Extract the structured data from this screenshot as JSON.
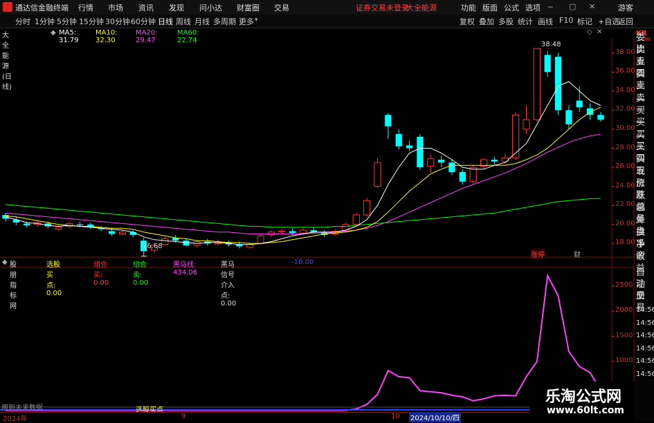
{
  "titlebar": {
    "app_name": "通达信金融终端",
    "menus": [
      "行情",
      "市场",
      "资讯",
      "发现",
      "问小达",
      "财富圈",
      "交易"
    ],
    "warning": "证券交易未登录",
    "stock_name": "大全能源",
    "right_menus": [
      "功能",
      "版面",
      "公式",
      "选项"
    ],
    "user": "游客"
  },
  "tabs": {
    "periods": [
      "分时",
      "1分钟",
      "5分钟",
      "15分钟",
      "30分钟",
      "60分钟",
      "日线",
      "周线",
      "月线",
      "多周期",
      "更多"
    ],
    "active": "日线",
    "tools": [
      "复权",
      "叠加",
      "多股",
      "统计",
      "画线",
      "F10",
      "标记",
      "+自选",
      "返回"
    ]
  },
  "legend": {
    "title": "大全能源(日线)",
    "ma5": "MA5: 31.79",
    "ma10": "MA10: 32.30",
    "ma20": "MA20: 29.47",
    "ma60": "MA60: 22.74",
    "colors": {
      "ma5": "#ffffff",
      "ma10": "#ffff00",
      "ma20": "#ff40ff",
      "ma60": "#00ff00"
    }
  },
  "price_axis": {
    "ticks": [
      "38.00",
      "36.00",
      "34.00",
      "32.00",
      "30.00",
      "28.00",
      "26.00",
      "24.00",
      "22.00",
      "20.00",
      "18.00"
    ],
    "max_label": "38.48",
    "min_label": "16.68"
  },
  "kline_labels": {
    "tags": [
      "涨停",
      "财"
    ]
  },
  "right_panel": {
    "top_code": "KR",
    "top_num": "300",
    "items": [
      "委比",
      "卖五",
      "卖四",
      "卖三",
      "卖二",
      "卖一",
      "买一",
      "买二",
      "买三",
      "买四",
      "买五",
      "现价",
      "涨跌",
      "涨幅",
      "总量",
      "外盘",
      "换手",
      "净资",
      "收益"
    ],
    "bottom_items": [
      "自动",
      "注册",
      "交易"
    ],
    "times": [
      "14:56",
      "14:56",
      "14:56",
      "14:56",
      "14:56",
      "14:56"
    ]
  },
  "indicator": {
    "legend": {
      "name": "股朋指标网",
      "buy": "选股买点: 0.00",
      "combo_buy": "组合买: 0.00",
      "combo_sell": "组合卖: 0.00",
      "darkhorse": "黑马线: 434.06",
      "darkhorse_entry": "黑马信号介入点: 0.00",
      "extra": "-10.00"
    },
    "ticks": [
      "2500",
      "2000",
      "1500",
      "1000",
      "500"
    ],
    "bottom_label_left": "用到未来数据",
    "bottom_label_mid": "选股买点"
  },
  "date_axis": {
    "labels": [
      "2024年",
      "9",
      "10",
      "2024/10/10/四"
    ]
  },
  "watermark": {
    "line1": "乐淘公式网",
    "line2": "www.60lt.com"
  },
  "chart_data": {
    "type": "candlestick",
    "ylim": [
      16.5,
      39.5
    ],
    "candles": [
      {
        "o": 21.0,
        "c": 20.6,
        "h": 21.2,
        "l": 20.3
      },
      {
        "o": 20.5,
        "c": 20.2,
        "h": 20.8,
        "l": 19.9
      },
      {
        "o": 20.1,
        "c": 19.9,
        "h": 20.3,
        "l": 19.7
      },
      {
        "o": 20.0,
        "c": 20.2,
        "h": 20.4,
        "l": 19.8
      },
      {
        "o": 20.1,
        "c": 19.8,
        "h": 20.3,
        "l": 19.6
      },
      {
        "o": 19.5,
        "c": 19.7,
        "h": 19.9,
        "l": 19.3
      },
      {
        "o": 19.8,
        "c": 20.1,
        "h": 20.3,
        "l": 19.6
      },
      {
        "o": 20.0,
        "c": 19.9,
        "h": 20.3,
        "l": 19.7
      },
      {
        "o": 20.0,
        "c": 19.7,
        "h": 20.2,
        "l": 19.5
      },
      {
        "o": 19.6,
        "c": 19.5,
        "h": 19.8,
        "l": 19.3
      },
      {
        "o": 19.3,
        "c": 19.0,
        "h": 19.6,
        "l": 18.8
      },
      {
        "o": 19.0,
        "c": 19.2,
        "h": 19.4,
        "l": 18.9
      },
      {
        "o": 19.2,
        "c": 18.9,
        "h": 19.4,
        "l": 18.7
      },
      {
        "o": 18.3,
        "c": 17.2,
        "h": 18.6,
        "l": 16.68
      },
      {
        "o": 17.3,
        "c": 17.8,
        "h": 18.1,
        "l": 17.1
      },
      {
        "o": 17.9,
        "c": 18.5,
        "h": 18.7,
        "l": 17.8
      },
      {
        "o": 18.6,
        "c": 18.3,
        "h": 18.9,
        "l": 18.1
      },
      {
        "o": 18.3,
        "c": 17.8,
        "h": 18.5,
        "l": 17.7
      },
      {
        "o": 17.8,
        "c": 18.2,
        "h": 18.4,
        "l": 17.6
      },
      {
        "o": 18.2,
        "c": 18.0,
        "h": 18.5,
        "l": 17.8
      },
      {
        "o": 18.0,
        "c": 18.1,
        "h": 18.4,
        "l": 17.8
      },
      {
        "o": 18.1,
        "c": 17.9,
        "h": 18.3,
        "l": 17.7
      },
      {
        "o": 17.9,
        "c": 17.7,
        "h": 18.2,
        "l": 17.5
      },
      {
        "o": 17.6,
        "c": 17.9,
        "h": 18.1,
        "l": 17.5
      },
      {
        "o": 18.0,
        "c": 18.8,
        "h": 19.0,
        "l": 17.9
      },
      {
        "o": 18.9,
        "c": 19.2,
        "h": 19.4,
        "l": 18.7
      },
      {
        "o": 19.2,
        "c": 19.3,
        "h": 19.5,
        "l": 19.0
      },
      {
        "o": 19.3,
        "c": 19.1,
        "h": 19.6,
        "l": 18.9
      },
      {
        "o": 19.1,
        "c": 19.4,
        "h": 19.7,
        "l": 18.9
      },
      {
        "o": 19.4,
        "c": 19.2,
        "h": 19.7,
        "l": 19.0
      },
      {
        "o": 19.2,
        "c": 18.9,
        "h": 19.4,
        "l": 18.7
      },
      {
        "o": 19.0,
        "c": 19.3,
        "h": 19.5,
        "l": 18.8
      },
      {
        "o": 19.3,
        "c": 20.0,
        "h": 20.2,
        "l": 19.2
      },
      {
        "o": 20.0,
        "c": 21.0,
        "h": 21.2,
        "l": 19.9
      },
      {
        "o": 21.0,
        "c": 22.5,
        "h": 22.8,
        "l": 20.8
      },
      {
        "o": 24.0,
        "c": 26.5,
        "h": 27.0,
        "l": 23.8
      },
      {
        "o": 31.5,
        "c": 30.3,
        "h": 31.7,
        "l": 29.0
      },
      {
        "o": 29.5,
        "c": 28.2,
        "h": 30.0,
        "l": 27.9
      },
      {
        "o": 28.3,
        "c": 28.0,
        "h": 28.8,
        "l": 27.7
      },
      {
        "o": 29.2,
        "c": 26.0,
        "h": 29.5,
        "l": 25.7
      },
      {
        "o": 26.1,
        "c": 26.9,
        "h": 27.3,
        "l": 25.4
      },
      {
        "o": 26.8,
        "c": 26.5,
        "h": 27.2,
        "l": 26.0
      },
      {
        "o": 26.5,
        "c": 25.5,
        "h": 26.8,
        "l": 25.2
      },
      {
        "o": 25.5,
        "c": 24.5,
        "h": 25.8,
        "l": 24.2
      },
      {
        "o": 24.5,
        "c": 26.0,
        "h": 26.3,
        "l": 24.3
      },
      {
        "o": 26.1,
        "c": 26.8,
        "h": 27.0,
        "l": 25.8
      },
      {
        "o": 26.8,
        "c": 26.6,
        "h": 27.1,
        "l": 26.3
      },
      {
        "o": 26.6,
        "c": 27.0,
        "h": 27.4,
        "l": 26.4
      },
      {
        "o": 27.0,
        "c": 31.5,
        "h": 31.8,
        "l": 26.8
      },
      {
        "o": 30.0,
        "c": 31.0,
        "h": 32.5,
        "l": 29.5
      },
      {
        "o": 31.0,
        "c": 38.48,
        "h": 38.48,
        "l": 30.8
      },
      {
        "o": 37.8,
        "c": 36.0,
        "h": 38.2,
        "l": 35.5
      },
      {
        "o": 37.6,
        "c": 32.0,
        "h": 38.0,
        "l": 31.5
      },
      {
        "o": 32.0,
        "c": 30.5,
        "h": 32.5,
        "l": 30.0
      },
      {
        "o": 33.0,
        "c": 32.3,
        "h": 34.5,
        "l": 31.8
      },
      {
        "o": 32.2,
        "c": 31.5,
        "h": 32.7,
        "l": 31.0
      },
      {
        "o": 31.5,
        "c": 31.0,
        "h": 31.8,
        "l": 30.8
      }
    ],
    "ma5": [
      20.8,
      20.5,
      20.2,
      20.1,
      19.9,
      19.8,
      19.9,
      19.8,
      19.7,
      19.6,
      19.5,
      19.4,
      19.2,
      18.7,
      18.4,
      18.3,
      18.2,
      18.1,
      18.0,
      18.1,
      18.1,
      18.0,
      17.9,
      17.9,
      18.0,
      18.2,
      18.5,
      18.8,
      19.0,
      19.2,
      19.2,
      19.2,
      19.4,
      19.8,
      20.5,
      22.0,
      24.2,
      26.0,
      27.5,
      28.0,
      28.0,
      27.5,
      26.8,
      26.0,
      25.8,
      25.8,
      26.2,
      26.5,
      27.5,
      28.5,
      30.5,
      32.5,
      34.5,
      35.0,
      34.0,
      33.0,
      32.5
    ],
    "ma10": [
      20.9,
      20.8,
      20.6,
      20.4,
      20.2,
      20.0,
      19.9,
      19.8,
      19.8,
      19.7,
      19.6,
      19.6,
      19.5,
      19.2,
      19.0,
      18.8,
      18.6,
      18.5,
      18.3,
      18.3,
      18.2,
      18.1,
      18.1,
      18.0,
      18.0,
      18.1,
      18.2,
      18.4,
      18.6,
      18.8,
      19.0,
      19.1,
      19.2,
      19.4,
      19.7,
      20.3,
      21.3,
      22.4,
      23.5,
      24.4,
      25.3,
      25.8,
      26.2,
      26.2,
      26.2,
      26.2,
      26.2,
      26.2,
      26.4,
      26.8,
      27.3,
      28.0,
      29.0,
      30.0,
      31.0,
      31.8,
      32.3
    ],
    "ma20": [
      21.2,
      21.1,
      21.0,
      20.9,
      20.8,
      20.7,
      20.6,
      20.5,
      20.4,
      20.3,
      20.2,
      20.1,
      20.0,
      19.9,
      19.8,
      19.7,
      19.6,
      19.5,
      19.4,
      19.3,
      19.2,
      19.2,
      19.1,
      19.0,
      19.0,
      19.0,
      19.0,
      19.0,
      19.0,
      19.1,
      19.1,
      19.2,
      19.3,
      19.4,
      19.6,
      19.9,
      20.3,
      20.8,
      21.3,
      21.8,
      22.3,
      22.8,
      23.3,
      23.8,
      24.2,
      24.6,
      25.0,
      25.4,
      25.9,
      26.4,
      27.0,
      27.6,
      28.1,
      28.6,
      29.0,
      29.3,
      29.47
    ],
    "ma60": [
      22.1,
      22.0,
      21.9,
      21.8,
      21.7,
      21.6,
      21.5,
      21.4,
      21.3,
      21.2,
      21.1,
      21.0,
      20.9,
      20.8,
      20.7,
      20.6,
      20.5,
      20.4,
      20.3,
      20.2,
      20.1,
      20.0,
      19.9,
      19.8,
      19.8,
      19.7,
      19.7,
      19.7,
      19.7,
      19.7,
      19.7,
      19.8,
      19.8,
      19.9,
      20.0,
      20.1,
      20.2,
      20.3,
      20.4,
      20.5,
      20.6,
      20.7,
      20.8,
      20.9,
      21.0,
      21.1,
      21.2,
      21.4,
      21.6,
      21.8,
      22.0,
      22.2,
      22.4,
      22.5,
      22.6,
      22.7,
      22.74
    ],
    "darkhorse": [
      30,
      30,
      30,
      30,
      30,
      30,
      30,
      30,
      30,
      30,
      30,
      30,
      30,
      30,
      30,
      30,
      30,
      30,
      30,
      30,
      30,
      30,
      30,
      30,
      30,
      30,
      30,
      30,
      30,
      30,
      30,
      30,
      30,
      60,
      150,
      350,
      820,
      700,
      680,
      420,
      400,
      380,
      330,
      300,
      220,
      260,
      320,
      330,
      320,
      700,
      1000,
      2700,
      2300,
      1200,
      900,
      780,
      434
    ]
  }
}
